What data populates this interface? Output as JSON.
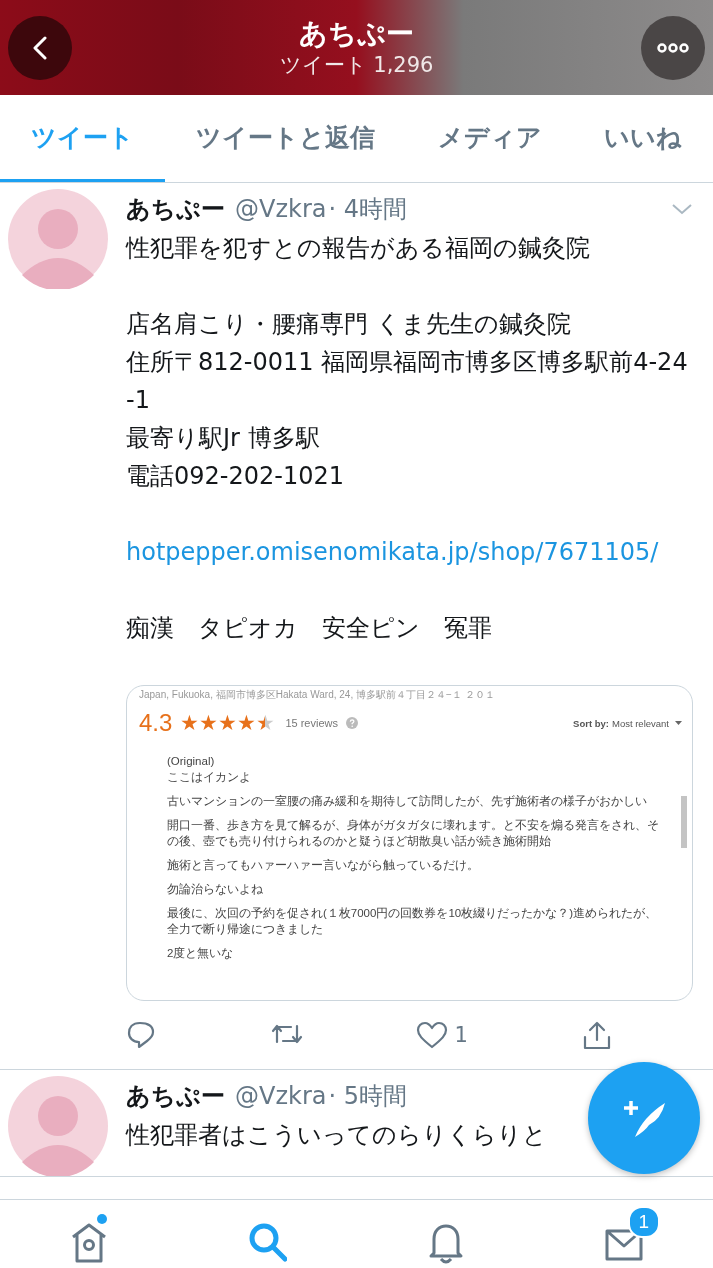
{
  "header": {
    "title": "あちぷー",
    "subtitle": "ツイート 1,296"
  },
  "tabs": [
    {
      "label": "ツイート",
      "selected": true
    },
    {
      "label": "ツイートと返信",
      "selected": false
    },
    {
      "label": "メディア",
      "selected": false
    },
    {
      "label": "いいね",
      "selected": false
    }
  ],
  "tweets": [
    {
      "name": "あちぷー",
      "handle": "@Vzkra",
      "time": "· 4時間",
      "menu": true,
      "blocks": [
        {
          "kind": "text",
          "lines": [
            "性犯罪を犯すとの報告がある福岡の鍼灸院"
          ]
        },
        {
          "kind": "text",
          "lines": [
            "店名肩こり・腰痛専門 くま先生の鍼灸院",
            "住所〒812-0011 福岡県福岡市博多区博多駅前4-24-1",
            "最寄り駅Jr 博多駅",
            "電話092-202-1021"
          ]
        },
        {
          "kind": "link",
          "lines": [
            "hotpepper.omisenomikata.jp/shop/7671105/"
          ]
        },
        {
          "kind": "text",
          "lines": [
            "痴漢　タピオカ　安全ピン　冤罪"
          ]
        }
      ],
      "review_card": {
        "address": "Japan, Fukuoka, 福岡市博多区Hakata Ward, 24, 博多駅前４丁目２４−１ ２０１",
        "rating": "4.3",
        "stars": 4.5,
        "count": "15 reviews",
        "sort_label": "Sort by:",
        "sort_value": "Most relevant",
        "paragraphs": [
          "(Original)\nここはイカンよ",
          "古いマンションの一室腰の痛み緩和を期待して訪問したが、先ず施術者の様子がおかしい",
          "開口一番、歩き方を見て解るが、身体がガタガタに壊れます。と不安を煽る発言をされ、その後、壺でも売り付けられるのかと疑うほど胡散臭い話が続き施術開始",
          "施術と言ってもハァーハァー言いながら触っているだけ。",
          "勿論治らないよね",
          "最後に、次回の予約を促され(１枚7000円の回数券を10枚綴りだったかな？)進められたが、全力で断り帰途につきました",
          "2度と無いな"
        ]
      },
      "actions": {
        "likes": "1"
      }
    },
    {
      "name": "あちぷー",
      "handle": "@Vzkra",
      "time": "· 5時間",
      "menu": false,
      "blocks": [
        {
          "kind": "text",
          "lines": [
            "性犯罪者はこういってのらりくらりと"
          ]
        }
      ]
    }
  ],
  "nav": [
    {
      "kind": "home",
      "selected": false,
      "dot": true
    },
    {
      "kind": "search",
      "selected": true,
      "dot": false
    },
    {
      "kind": "bell",
      "selected": false,
      "dot": false
    },
    {
      "kind": "mail",
      "selected": false,
      "dot": false,
      "badge": "1"
    }
  ]
}
